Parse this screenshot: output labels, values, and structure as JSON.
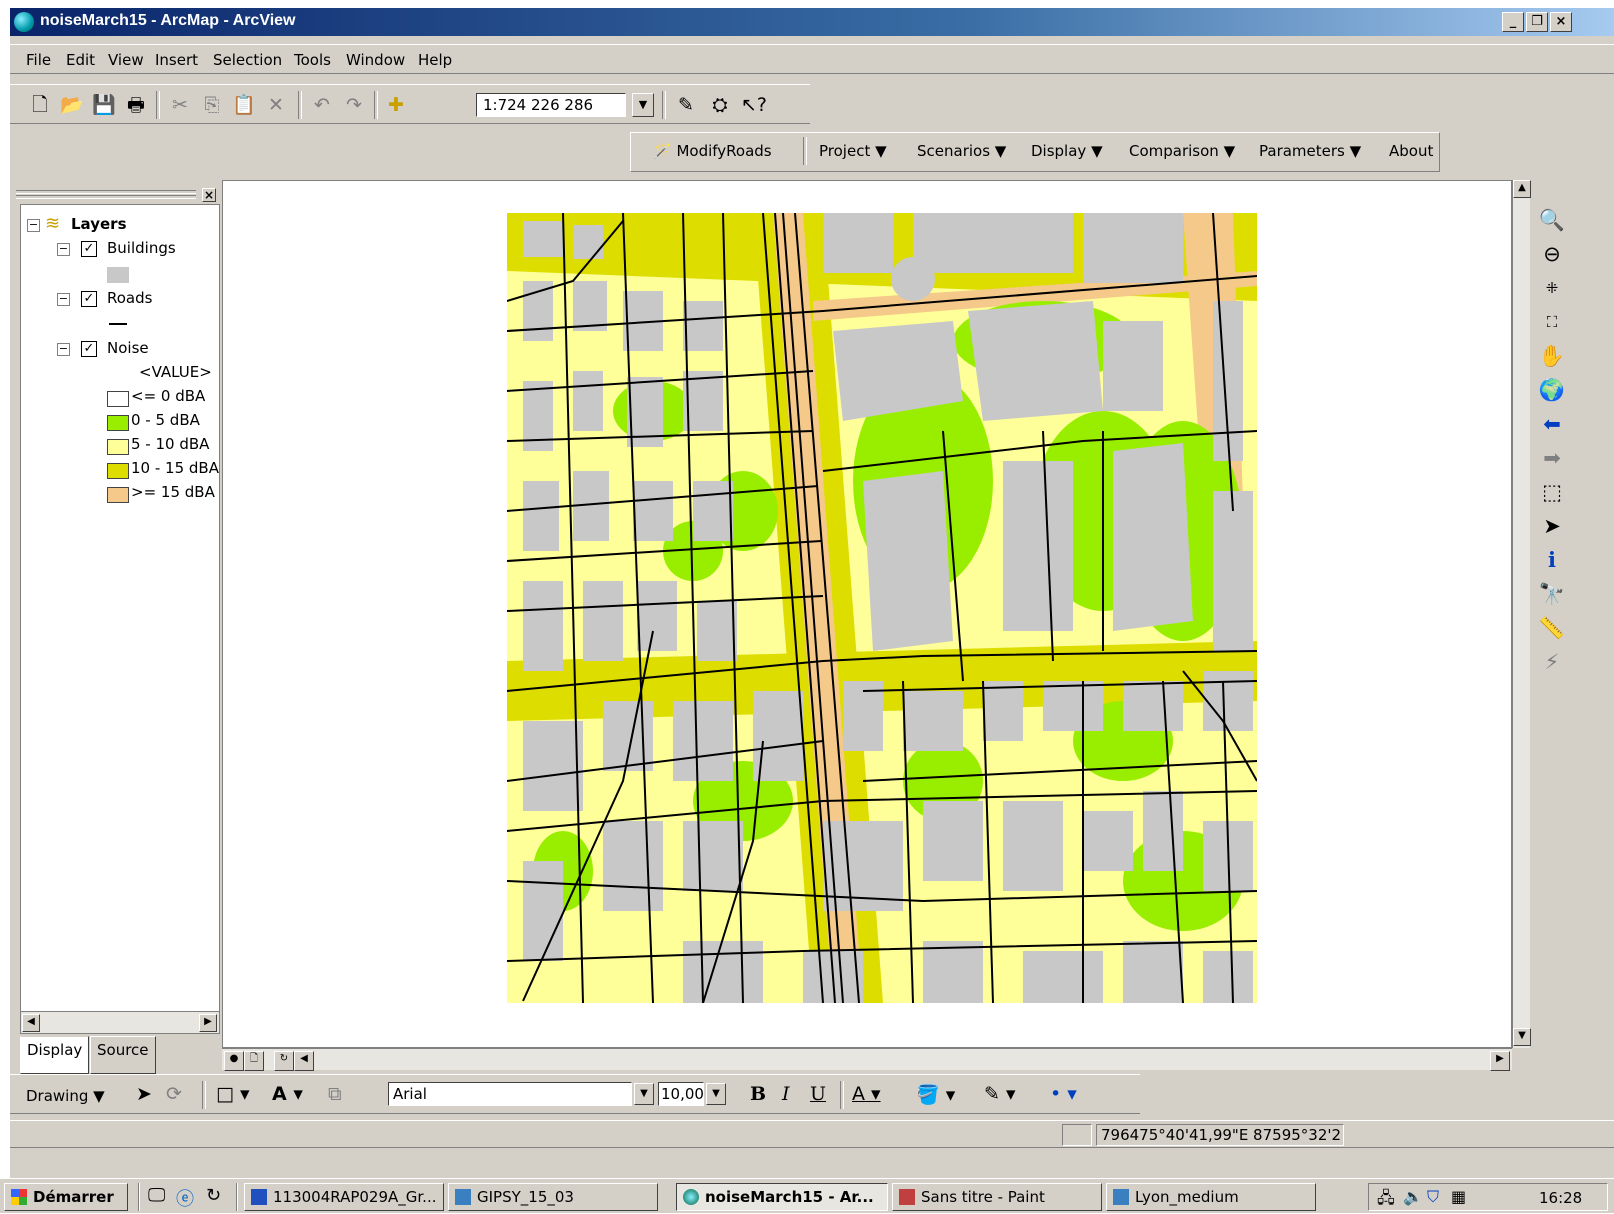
{
  "window": {
    "title": "noiseMarch15 - ArcMap - ArcView"
  },
  "menu": [
    "File",
    "Edit",
    "View",
    "Insert",
    "Selection",
    "Tools",
    "Window",
    "Help"
  ],
  "toolbar": {
    "scale": "1:724 226 286"
  },
  "toolbar2": {
    "modify_roads": "ModifyRoads",
    "items": [
      "Project",
      "Scenarios",
      "Display",
      "Comparison",
      "Parameters"
    ],
    "about": "About"
  },
  "toc": {
    "root": "Layers",
    "layers": [
      {
        "name": "Buildings",
        "checked": true
      },
      {
        "name": "Roads",
        "checked": true
      },
      {
        "name": "Noise",
        "checked": true
      }
    ],
    "noise_field": "<VALUE>",
    "classes": [
      {
        "label": "<= 0 dBA",
        "color": "#ffffff"
      },
      {
        "label": "0 - 5 dBA",
        "color": "#99ee00"
      },
      {
        "label": "5 - 10 dBA",
        "color": "#ffff99"
      },
      {
        "label": "10 - 15 dBA",
        "color": "#dddd00"
      },
      {
        "label": ">= 15 dBA",
        "color": "#f5c98a"
      }
    ],
    "tabs": [
      "Display",
      "Source"
    ]
  },
  "drawing": {
    "label": "Drawing",
    "font": "Arial",
    "size": "10,00"
  },
  "status": {
    "coords": "796475°40'41,99\"E 87595°32'2"
  },
  "taskbar": {
    "start": "Démarrer",
    "tasks": [
      "113004RAP029A_Gr...",
      "GIPSY_15_03",
      "noiseMarch15 - Ar...",
      "Sans titre - Paint",
      "Lyon_medium"
    ],
    "clock": "16:28"
  },
  "map": {
    "building_color": "#c8c8c8",
    "road_color": "#000000"
  }
}
